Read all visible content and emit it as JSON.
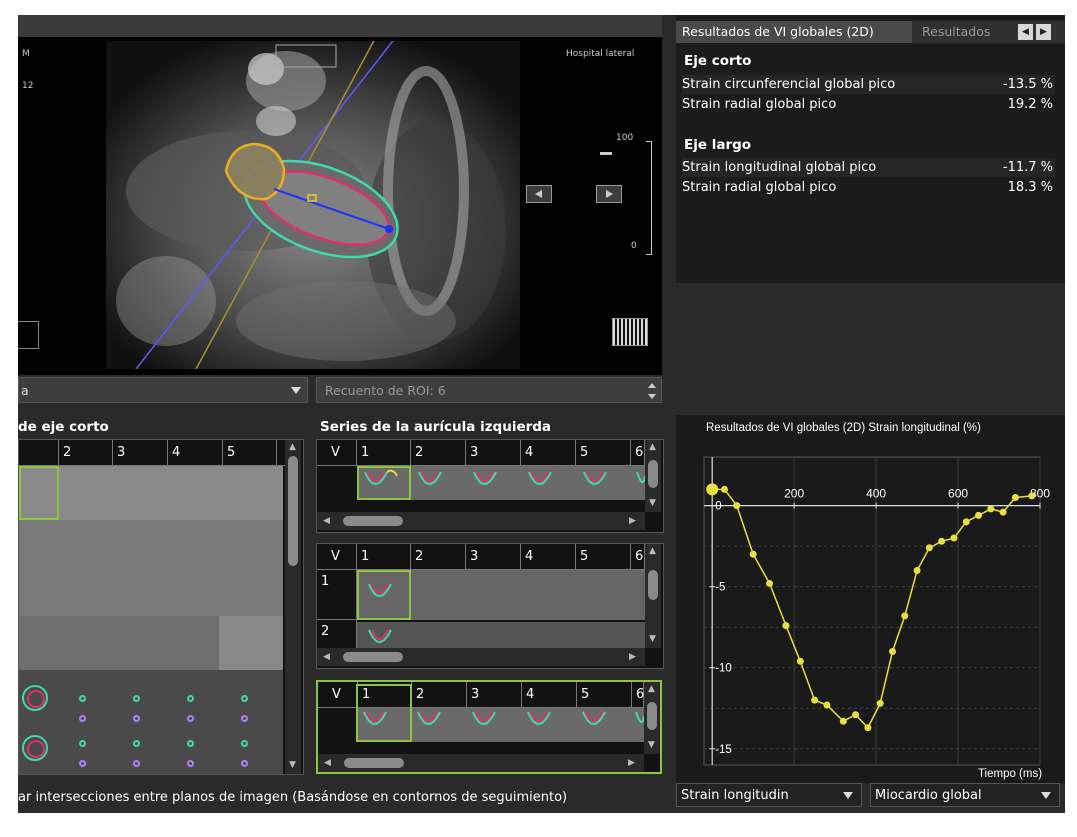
{
  "viewer": {
    "overlay_left": [
      "M",
      "12"
    ],
    "overlay_right": "Hospital lateral",
    "scale_top": "100",
    "scale_bottom": "0"
  },
  "results": {
    "tabs": [
      "Resultados de VI globales (2D)",
      "Resultados"
    ],
    "tab_arrows": [
      "◀",
      "▶"
    ],
    "short_axis": {
      "title": "Eje corto",
      "rows": [
        {
          "label": "Strain circunferencial global pico",
          "value": "-13.5 %"
        },
        {
          "label": "Strain radial global pico",
          "value": "19.2 %"
        }
      ]
    },
    "long_axis": {
      "title": "Eje largo",
      "rows": [
        {
          "label": "Strain longitudinal global pico",
          "value": "-11.7 %"
        },
        {
          "label": "Strain radial global pico",
          "value": "18.3 %"
        }
      ]
    }
  },
  "controls": {
    "left_dropdown": "a",
    "roi_count": "Recuento de ROI: 6"
  },
  "short_axis_grid": {
    "title": "de eje corto",
    "columns": [
      "2",
      "3",
      "4",
      "5"
    ]
  },
  "la_series": {
    "title": "Series de la aurícula izquierda",
    "panels": [
      {
        "corner": "V",
        "columns": [
          "1",
          "2",
          "3",
          "4",
          "5",
          "6"
        ],
        "rows": []
      },
      {
        "corner": "V",
        "columns": [
          "1",
          "2",
          "3",
          "4",
          "5",
          "6"
        ],
        "rows": [
          "1",
          "2"
        ]
      },
      {
        "corner": "V",
        "columns": [
          "1",
          "2",
          "3",
          "4",
          "5",
          "6"
        ],
        "rows": []
      }
    ]
  },
  "status_text": "ar intersecciones entre planos de imagen (Basándose en contornos de seguimiento)",
  "bottom_dropdowns": [
    "Strain longitudin",
    "Miocardio global"
  ],
  "colors": {
    "curve": "#e8e040",
    "green_select": "#8cc63f",
    "pink_contour": "#e0306a",
    "teal_contour": "#40d8b0"
  },
  "chart_data": {
    "type": "line",
    "title": "Resultados de VI globales (2D) Strain longitudinal (%)",
    "xlabel": "Tiempo (ms)",
    "ylabel": "",
    "xticks": [
      "200",
      "400",
      "600",
      "800"
    ],
    "yticks": [
      "0",
      "-5",
      "-10",
      "-15"
    ],
    "xlim": [
      -20,
      800
    ],
    "ylim": [
      -16,
      3
    ],
    "grid": true,
    "series": [
      {
        "values": [
          {
            "x": 0,
            "y": 1.0
          },
          {
            "x": 30,
            "y": 1.0
          },
          {
            "x": 60,
            "y": 0.0
          },
          {
            "x": 100,
            "y": -3.0
          },
          {
            "x": 140,
            "y": -4.8
          },
          {
            "x": 180,
            "y": -7.4
          },
          {
            "x": 215,
            "y": -9.6
          },
          {
            "x": 250,
            "y": -12.0
          },
          {
            "x": 280,
            "y": -12.3
          },
          {
            "x": 320,
            "y": -13.3
          },
          {
            "x": 350,
            "y": -12.9
          },
          {
            "x": 380,
            "y": -13.7
          },
          {
            "x": 410,
            "y": -12.2
          },
          {
            "x": 440,
            "y": -9.0
          },
          {
            "x": 470,
            "y": -6.8
          },
          {
            "x": 500,
            "y": -4.0
          },
          {
            "x": 530,
            "y": -2.6
          },
          {
            "x": 560,
            "y": -2.2
          },
          {
            "x": 590,
            "y": -2.0
          },
          {
            "x": 620,
            "y": -1.0
          },
          {
            "x": 650,
            "y": -0.6
          },
          {
            "x": 680,
            "y": -0.2
          },
          {
            "x": 710,
            "y": -0.4
          },
          {
            "x": 740,
            "y": 0.5
          },
          {
            "x": 780,
            "y": 0.6
          }
        ]
      }
    ]
  }
}
